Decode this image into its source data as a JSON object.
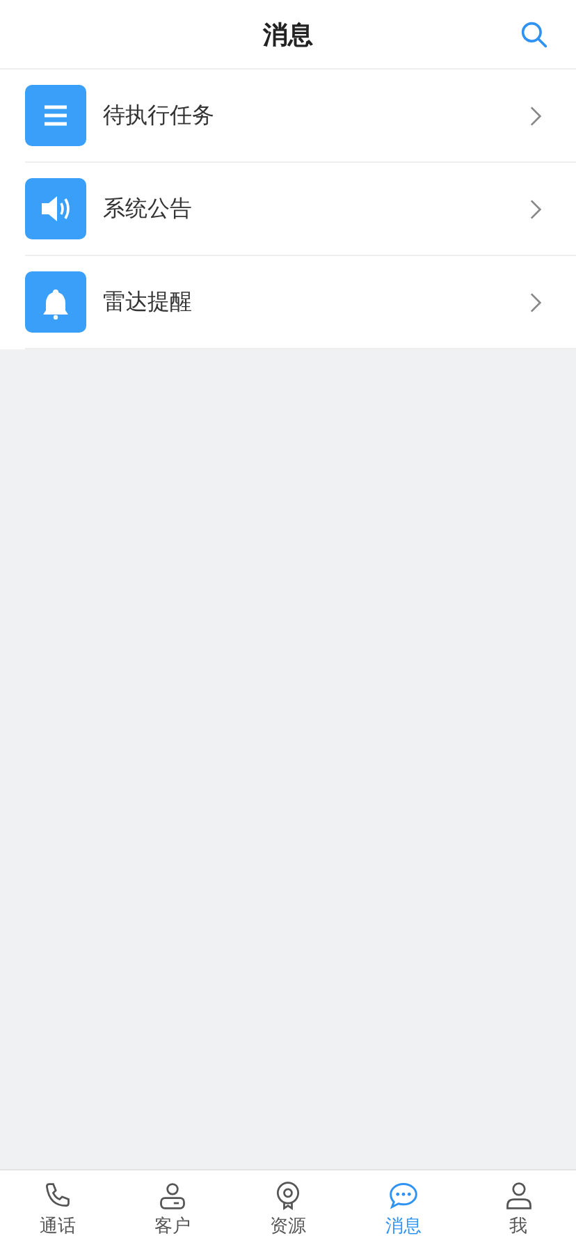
{
  "header": {
    "title": "消息"
  },
  "items": [
    {
      "kind": "list",
      "label": "待执行任务"
    },
    {
      "kind": "speaker",
      "label": "系统公告"
    },
    {
      "kind": "bell",
      "label": "雷达提醒"
    }
  ],
  "tabs": [
    {
      "kind": "phone",
      "label": "通话",
      "selected": false
    },
    {
      "kind": "customer",
      "label": "客户",
      "selected": false
    },
    {
      "kind": "resource",
      "label": "资源",
      "selected": false
    },
    {
      "kind": "chat",
      "label": "消息",
      "selected": true
    },
    {
      "kind": "me",
      "label": "我",
      "selected": false
    }
  ]
}
